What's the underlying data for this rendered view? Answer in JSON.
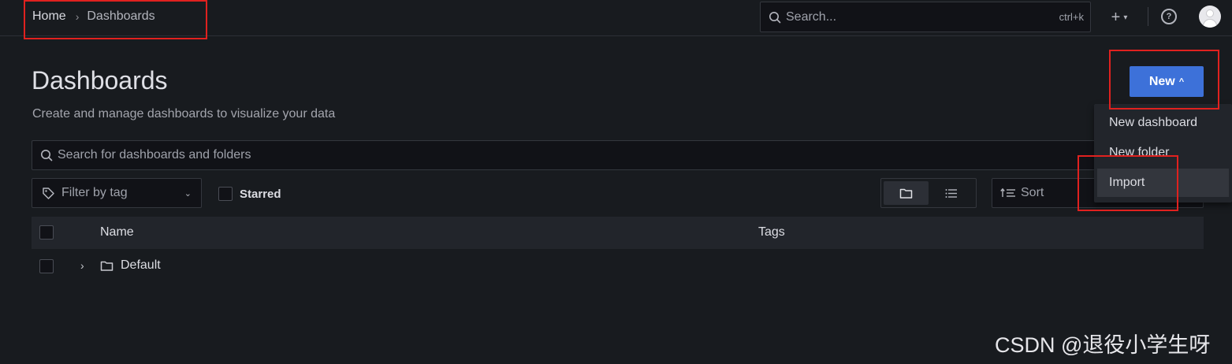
{
  "breadcrumb": {
    "home": "Home",
    "separator": "›",
    "current": "Dashboards"
  },
  "top_search": {
    "placeholder": "Search...",
    "shortcut": "ctrl+k"
  },
  "top_actions": {
    "add_icon": "plus-icon",
    "help_icon": "help-circle-icon",
    "avatar": "user-avatar"
  },
  "header": {
    "title": "Dashboards",
    "subtitle": "Create and manage dashboards to visualize your data",
    "new_button": "New"
  },
  "new_menu": {
    "items": [
      {
        "label": "New dashboard"
      },
      {
        "label": "New folder"
      },
      {
        "label": "Import"
      }
    ]
  },
  "search": {
    "placeholder": "Search for dashboards and folders"
  },
  "filters": {
    "tag_filter": "Filter by tag",
    "starred": "Starred",
    "sort": "Sort",
    "view_options": [
      "folder-view",
      "list-view"
    ]
  },
  "table": {
    "columns": [
      "Name",
      "Tags"
    ],
    "rows": [
      {
        "name": "Default",
        "type": "folder",
        "tags": ""
      }
    ]
  },
  "watermark": "CSDN @退役小学生呀",
  "colors": {
    "accent": "#3d71d9",
    "background": "#181b1f",
    "highlight": "#e0211f"
  }
}
